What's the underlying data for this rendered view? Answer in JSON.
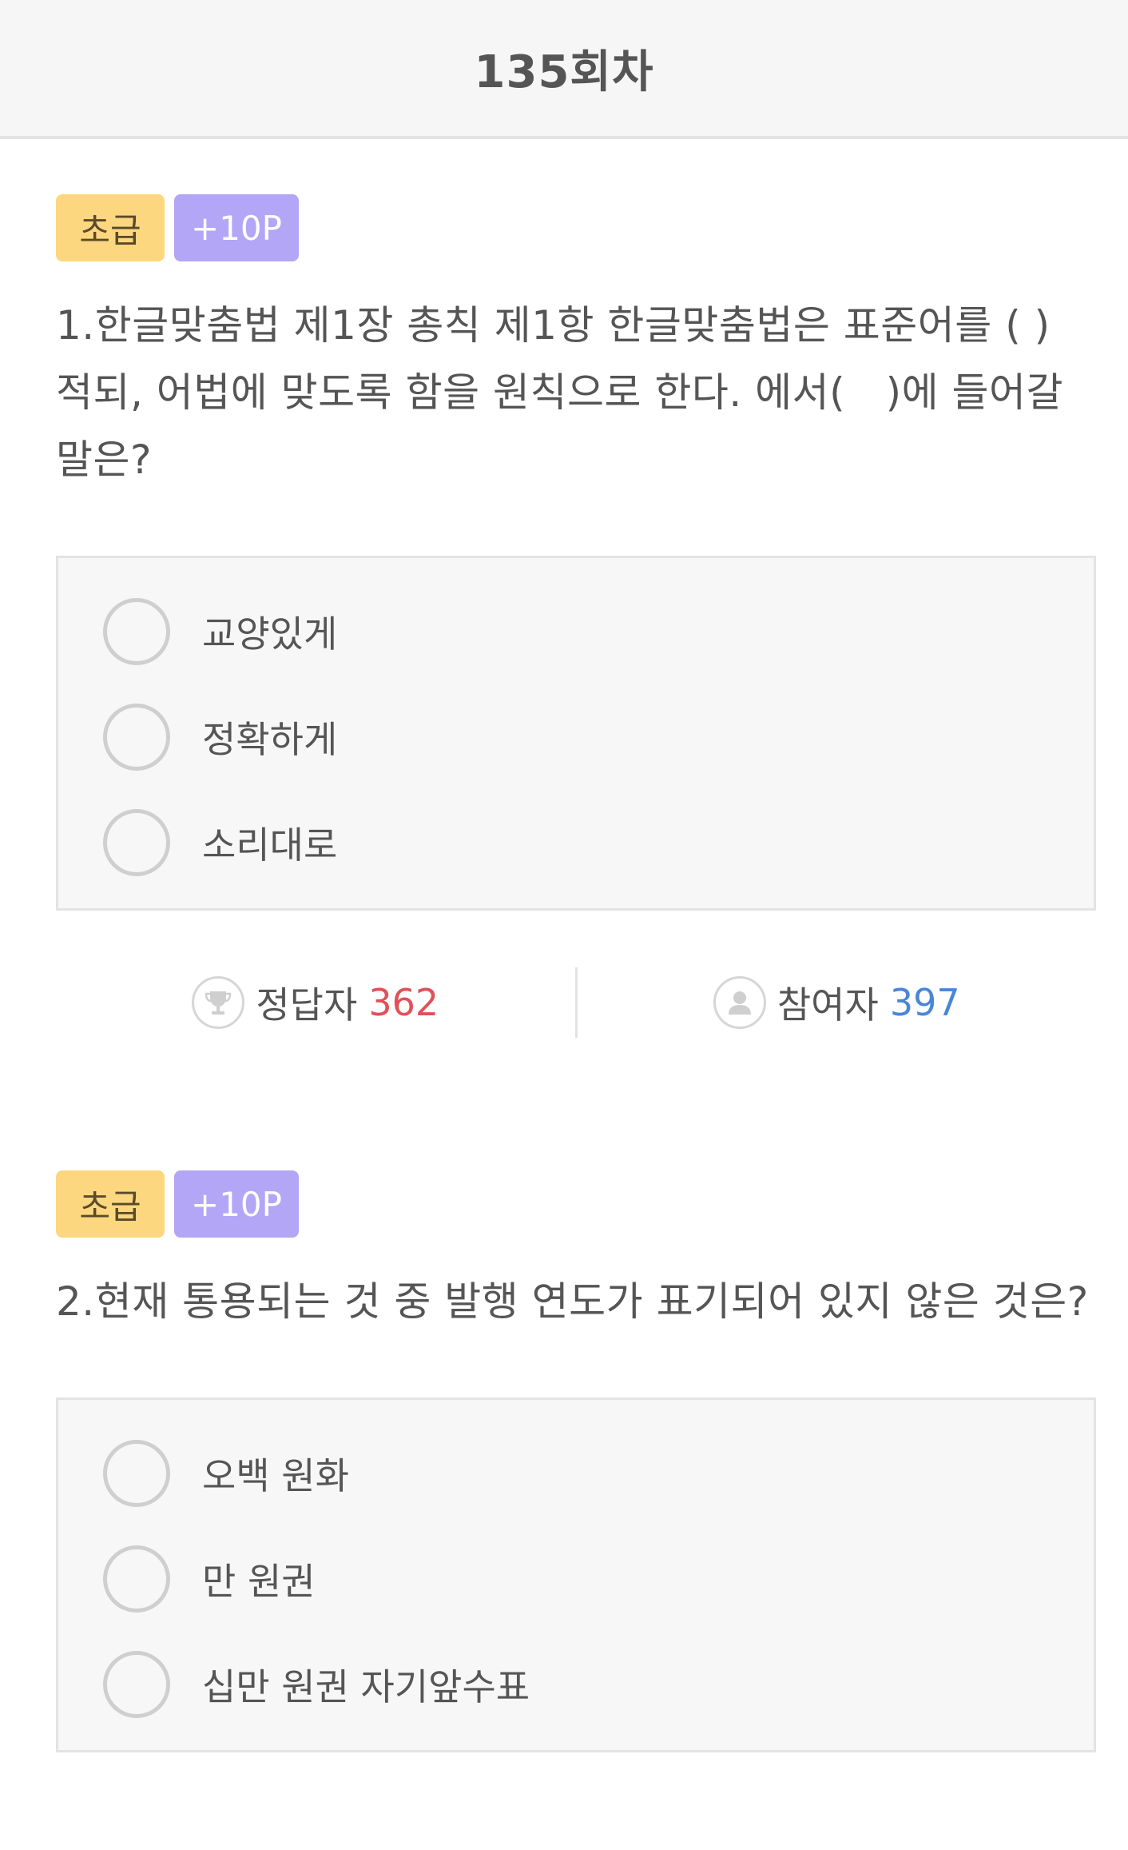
{
  "header": {
    "title": "135회차"
  },
  "questions": [
    {
      "level": "초급",
      "points": "+10P",
      "text": "1.한글맞춤법 제1장 총칙 제1항 한글맞춤법은 표준어를 ( )적되, 어법에 맞도록 함을 원칙으로 한다. 에서(　)에 들어갈 말은?",
      "options": [
        "교양있게",
        "정확하게",
        "소리대로"
      ],
      "stats": {
        "correct_label": "정답자",
        "correct_count": "362",
        "participants_label": "참여자",
        "participants_count": "397"
      }
    },
    {
      "level": "초급",
      "points": "+10P",
      "text": "2.현재 통용되는 것 중 발행 연도가 표기되어 있지 않은 것은?",
      "options": [
        "오백 원화",
        "만 원권",
        "십만 원권 자기앞수표"
      ]
    }
  ],
  "colors": {
    "level_badge": "#fcd77f",
    "point_badge": "#b4a6f6",
    "correct_count": "#e0515a",
    "participants_count": "#4a86d8"
  },
  "icons": {
    "correct": "trophy-icon",
    "participants": "user-icon",
    "option": "radio-button"
  }
}
